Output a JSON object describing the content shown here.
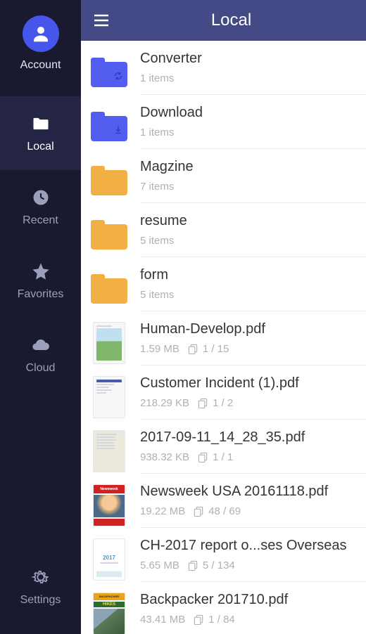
{
  "header": {
    "title": "Local"
  },
  "sidebar": {
    "account_label": "Account",
    "items": [
      {
        "label": "Local"
      },
      {
        "label": "Recent"
      },
      {
        "label": "Favorites"
      },
      {
        "label": "Cloud"
      }
    ],
    "settings_label": "Settings"
  },
  "files": [
    {
      "name": "Converter",
      "meta": "1 items",
      "type": "folder",
      "color": "blue",
      "badge": "sync"
    },
    {
      "name": "Download",
      "meta": "1 items",
      "type": "folder",
      "color": "blue",
      "badge": "download"
    },
    {
      "name": "Magzine",
      "meta": "7 items",
      "type": "folder",
      "color": "orange"
    },
    {
      "name": "resume",
      "meta": "5 items",
      "type": "folder",
      "color": "orange"
    },
    {
      "name": "form",
      "meta": "5 items",
      "type": "folder",
      "color": "orange"
    },
    {
      "name": "Human-Develop.pdf",
      "size": "1.59 MB",
      "pages": "1 / 15",
      "type": "pdf",
      "thumb": "photo"
    },
    {
      "name": "Customer Incident (1).pdf",
      "size": "218.29 KB",
      "pages": "1 / 2",
      "type": "pdf",
      "thumb": "doc"
    },
    {
      "name": "2017-09-11_14_28_35.pdf",
      "size": "938.32 KB",
      "pages": "1 / 1",
      "type": "pdf",
      "thumb": "scan"
    },
    {
      "name": "Newsweek USA 20161118.pdf",
      "size": "19.22 MB",
      "pages": "48 / 69",
      "type": "pdf",
      "thumb": "newsweek"
    },
    {
      "name": "CH-2017 report o...ses Overseas",
      "size": "5.65 MB",
      "pages": "5 / 134",
      "type": "pdf",
      "thumb": "report"
    },
    {
      "name": "Backpacker 201710.pdf",
      "size": "43.41 MB",
      "pages": "1 / 84",
      "type": "pdf",
      "thumb": "backpacker"
    }
  ]
}
